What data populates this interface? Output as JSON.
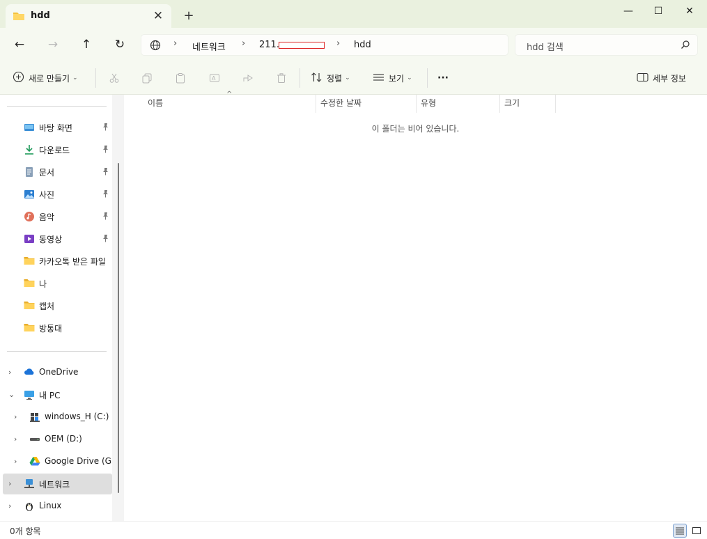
{
  "window": {
    "tab_title": "hdd",
    "tab_close": "✕",
    "new_tab": "+",
    "minimize": "—",
    "maximize": "☐",
    "close": "✕"
  },
  "nav": {
    "back": "←",
    "forward": "→",
    "up": "↑",
    "refresh": "↻"
  },
  "address": {
    "segments": [
      "네트워크",
      "211.",
      "hdd"
    ],
    "separator": "›"
  },
  "search": {
    "placeholder": "hdd 검색"
  },
  "toolbar": {
    "new_label": "새로 만들기",
    "sort_label": "정렬",
    "view_label": "보기",
    "more_label": "···",
    "details_label": "세부 정보",
    "dropdown_caret": "⌄"
  },
  "sidebar": {
    "quick_access": [
      {
        "label": "바탕 화면",
        "icon": "desktop-icon",
        "pinned": true
      },
      {
        "label": "다운로드",
        "icon": "download-icon",
        "pinned": true
      },
      {
        "label": "문서",
        "icon": "document-icon",
        "pinned": true
      },
      {
        "label": "사진",
        "icon": "pictures-icon",
        "pinned": true
      },
      {
        "label": "음악",
        "icon": "music-icon",
        "pinned": true
      },
      {
        "label": "동영상",
        "icon": "video-icon",
        "pinned": true
      },
      {
        "label": "카카오톡 받은 파일",
        "icon": "folder-icon",
        "pinned": false
      },
      {
        "label": "나",
        "icon": "folder-icon",
        "pinned": false
      },
      {
        "label": "캡처",
        "icon": "folder-icon",
        "pinned": false
      },
      {
        "label": "방통대",
        "icon": "folder-icon",
        "pinned": false
      }
    ],
    "onedrive": "OneDrive",
    "this_pc": "내 PC",
    "drives": [
      {
        "label": "windows_H (C:)",
        "icon": "windows-drive-icon"
      },
      {
        "label": "OEM (D:)",
        "icon": "drive-icon"
      },
      {
        "label": "Google Drive (G:)",
        "icon": "google-drive-icon"
      }
    ],
    "network": "네트워크",
    "linux": "Linux"
  },
  "content": {
    "columns": [
      "이름",
      "수정한 날짜",
      "유형",
      "크기"
    ],
    "empty_message": "이 폴더는 비어 있습니다."
  },
  "status": {
    "item_count": "0개 항목"
  },
  "colors": {
    "titlebar_bg": "#eaf1df",
    "toolbar_bg": "#f6f9f1",
    "folder_yellow": "#f4c13d",
    "selected_bg": "#dedede",
    "accent": "#0067c0"
  }
}
